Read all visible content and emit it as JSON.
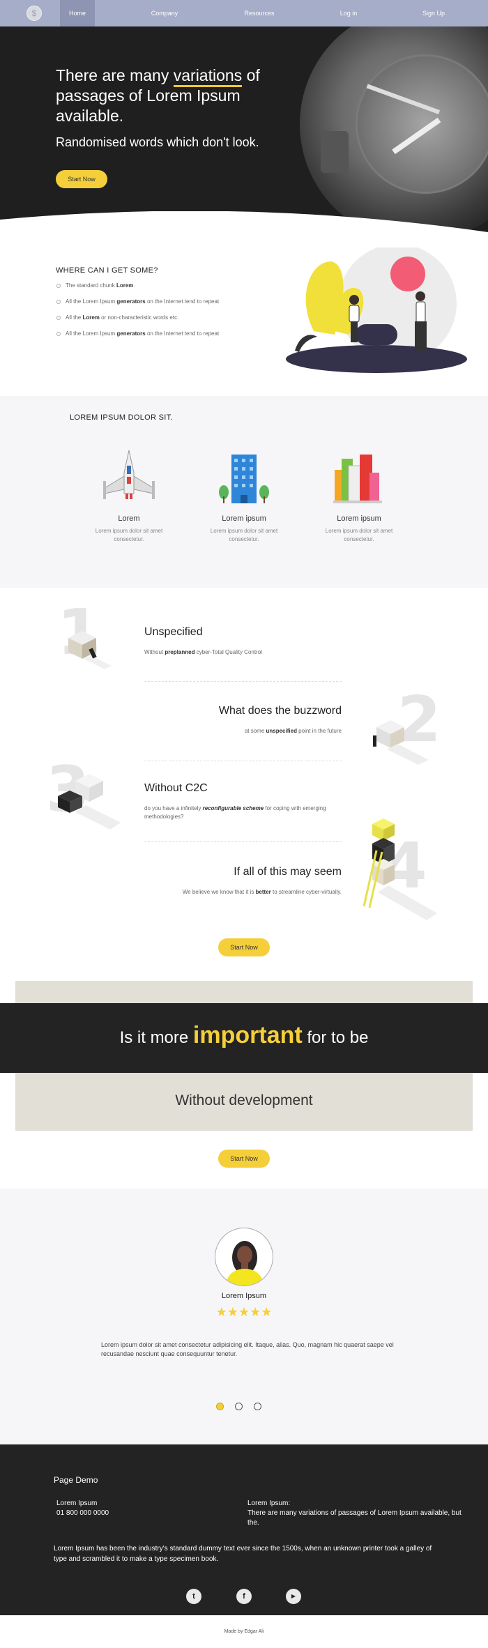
{
  "nav": {
    "logo_glyph": "$",
    "items": [
      {
        "label": "Home",
        "active": true
      },
      {
        "label": "Company"
      },
      {
        "label": "Resources"
      },
      {
        "label": "Log in"
      },
      {
        "label": "Sign Up"
      }
    ]
  },
  "hero": {
    "title_pre": "There are many ",
    "title_highlight": "variations",
    "title_post": " of passages of Lorem Ipsum available.",
    "subtitle": "Randomised words which don't look.",
    "cta": "Start Now"
  },
  "where": {
    "heading": "WHERE CAN I GET SOME?",
    "items": [
      {
        "pre": "The standard chunk ",
        "bold": "Lorem",
        "post": "."
      },
      {
        "pre": "All the Lorem Ipsum ",
        "bold": "generators",
        "post": " on the Internet tend to repeat"
      },
      {
        "pre": "All the ",
        "bold": "Lorem",
        "post": " or non-characteristic words etc."
      },
      {
        "pre": "All the Lorem Ipsum ",
        "bold": "generators",
        "post": " on the Internet tend to repeat"
      }
    ]
  },
  "dolor": {
    "heading": "LOREM IPSUM DOLOR SIT.",
    "cards": [
      {
        "title": "Lorem",
        "desc": "Lorem ipsum dolor sit amet consectetur.",
        "icon": "spaceship-icon"
      },
      {
        "title": "Lorem ipsum",
        "desc": "Lorem ipsum dolor sit amet consectetur.",
        "icon": "building-icon"
      },
      {
        "title": "Lorem ipsum",
        "desc": "Lorem ipsum dolor sit amet consectetur.",
        "icon": "city-icon"
      }
    ]
  },
  "steps": [
    {
      "num": "1",
      "title": "Unspecified",
      "pre": "Without ",
      "bold": "preplanned",
      "post": " cyber-Total Quality Control"
    },
    {
      "num": "2",
      "title": "What does the buzzword",
      "pre": "at some ",
      "bold": "unspecified",
      "post": " point in the future"
    },
    {
      "num": "3",
      "title": "Without C2C",
      "pre": "do you have a infinitely ",
      "bold": "reconfigurable scheme",
      "post": " for coping with emerging methodologies?"
    },
    {
      "num": "4",
      "title": "If all of this may seem",
      "pre": "We believe we know that it is ",
      "bold": "better",
      "post": " to streamline cyber-virtually."
    }
  ],
  "steps_cta": "Start Now",
  "banner": {
    "pre": "Is it more ",
    "highlight": "important",
    "post": " for to be",
    "sub": "Without development",
    "cta": "Start Now"
  },
  "testimonial": {
    "name": "Lorem Ipsum",
    "stars": "★★★★★",
    "quote": "Lorem ipsum dolor sit amet consectetur adipisicing elit. Itaque, alias. Quo, magnam hic quaerat saepe vel recusandae nesciunt quae consequuntur tenetur.",
    "rating": 5
  },
  "footer": {
    "title": "Page Demo",
    "col1_line1": "Lorem Ipsum",
    "col1_line2": "01 800 000 0000",
    "col2_line1": "Lorem Ipsum:",
    "col2_line2": "There are many variations of passages of Lorem Ipsum available, but the.",
    "paragraph": "Lorem Ipsum has been the industry's standard dummy text ever since the 1500s, when an unknown printer took a galley of type and scrambled it to make a type specimen book.",
    "social": [
      {
        "icon": "twitter-icon",
        "glyph": "t"
      },
      {
        "icon": "facebook-icon",
        "glyph": "f"
      },
      {
        "icon": "youtube-icon",
        "glyph": "▶"
      }
    ],
    "made_by": "Made by Edgar Ali"
  },
  "colors": {
    "accent": "#f5cf3a",
    "nav": "#a6adc8",
    "dark": "#242324"
  }
}
